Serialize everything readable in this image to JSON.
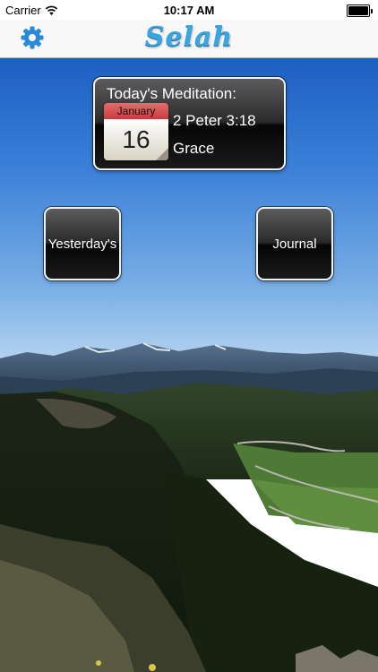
{
  "status_bar": {
    "carrier": "Carrier",
    "time": "10:17 AM",
    "battery_level": 1.0
  },
  "nav_bar": {
    "title": "Selah",
    "settings_icon": "gear-icon",
    "accent_color": "#3aa6e0"
  },
  "today": {
    "heading": "Today's Meditation:",
    "calendar_month": "January",
    "calendar_day": "16",
    "verse_reference": "2 Peter 3:18",
    "verse_topic": "Grace"
  },
  "buttons": {
    "yesterday_label": "Yesterday's",
    "journal_label": "Journal"
  }
}
